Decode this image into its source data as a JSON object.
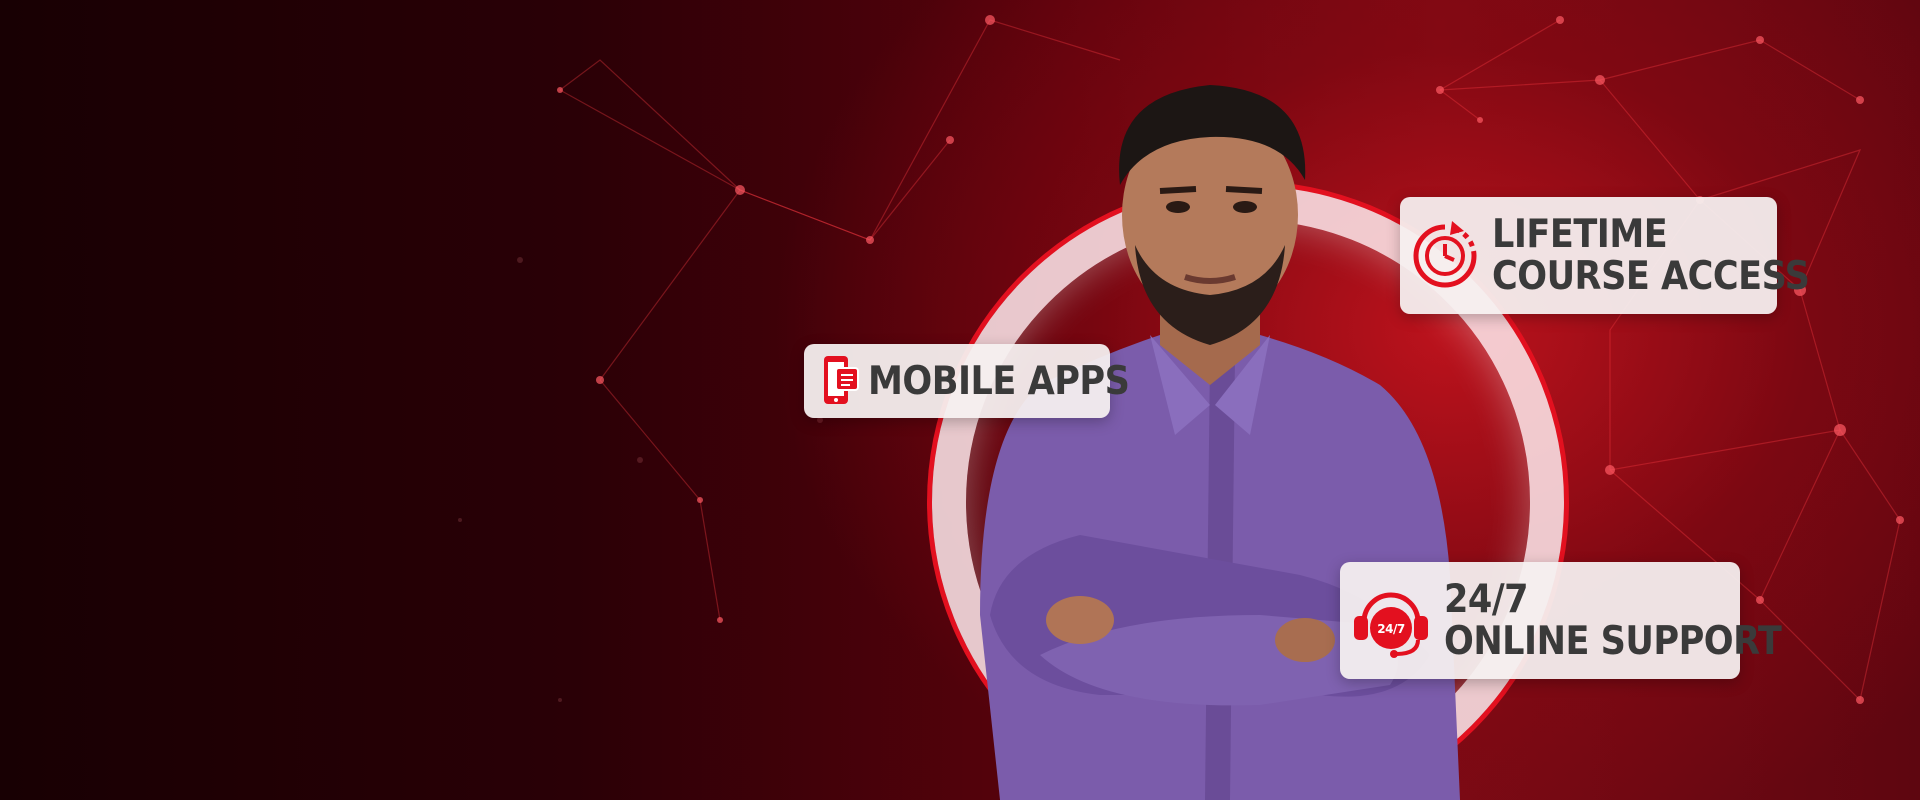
{
  "colors": {
    "background_dark": "#180003",
    "background_red": "#c8141e",
    "accent_red": "#e3101f",
    "badge_bg": "#f5f0f0",
    "badge_text": "#3a3a3a",
    "shirt_purple": "#7b5cab"
  },
  "hero": {
    "person_icon": "person-arms-crossed-photo"
  },
  "badges": {
    "mobile": {
      "icon": "mobile-phone-icon",
      "label": "MOBILE APPS"
    },
    "lifetime": {
      "icon": "clock-refresh-icon",
      "line1": "LIFETIME",
      "line2": "COURSE ACCESS"
    },
    "support": {
      "icon": "headset-support-icon",
      "icon_text": "24/7",
      "line1": "24/7",
      "line2": "ONLINE SUPPORT"
    }
  }
}
